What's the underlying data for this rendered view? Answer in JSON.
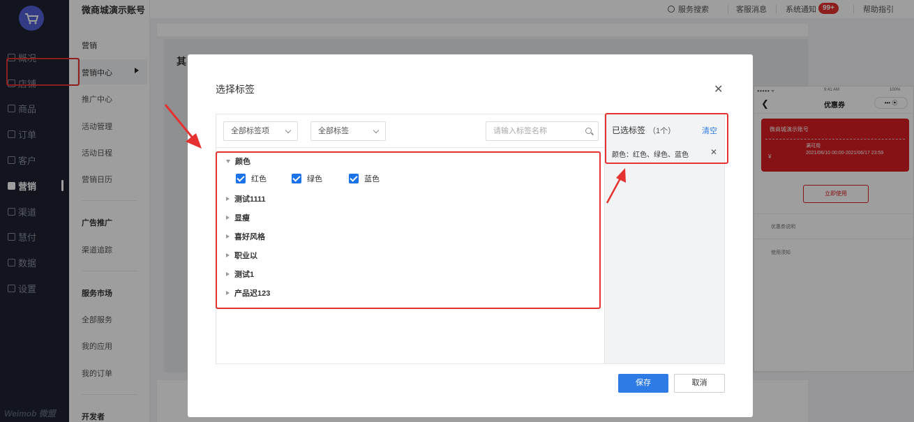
{
  "nav": {
    "items": [
      {
        "label": "概况",
        "icon": "overview-icon"
      },
      {
        "label": "店铺",
        "icon": "shop-icon"
      },
      {
        "label": "商品",
        "icon": "goods-icon"
      },
      {
        "label": "订单",
        "icon": "order-icon"
      },
      {
        "label": "客户",
        "icon": "customer-icon"
      },
      {
        "label": "营销",
        "icon": "marketing-icon"
      },
      {
        "label": "渠道",
        "icon": "channel-icon"
      },
      {
        "label": "慧付",
        "icon": "pay-icon"
      },
      {
        "label": "数据",
        "icon": "data-icon"
      },
      {
        "label": "设置",
        "icon": "settings-icon"
      }
    ],
    "brand": "Weimob 微盟"
  },
  "subnav": {
    "account": "微商城演示账号",
    "section1": "营销",
    "items1": [
      "营销中心",
      "推广中心",
      "活动管理",
      "活动日程",
      "营销日历"
    ],
    "section2": "广告推广",
    "items2": [
      "渠道追踪"
    ],
    "section3": "服务市场",
    "items3": [
      "全部服务",
      "我的应用",
      "我的订单"
    ],
    "section4": "开发者"
  },
  "topbar": {
    "search": "服务搜索",
    "messages": "客服消息",
    "notice": "系统通知",
    "notice_badge": "99+",
    "help": "帮助指引"
  },
  "background": {
    "partial_title": "其"
  },
  "phone": {
    "status_left": "●●●●● ᯤ",
    "status_time": "9:41 AM",
    "status_right": "100%",
    "title": "优惠券",
    "capsule": "•••  ⦿",
    "coupon_name": "微商城演示账号",
    "coupon_status": "满可用",
    "coupon_date": "2021/06/10 00:00-2021/06/17 23:59",
    "coupon_yen": "¥",
    "use_button": "立即使用",
    "label1": "优惠券说明",
    "label2": "使用须知"
  },
  "modal": {
    "title": "选择标签",
    "filter1": "全部标签项",
    "filter2": "全部标签",
    "search_placeholder": "请输入标签名称",
    "groups": [
      {
        "label": "颜色",
        "expanded": true,
        "options": [
          "红色",
          "绿色",
          "蓝色"
        ]
      },
      {
        "label": "测试1111",
        "expanded": false
      },
      {
        "label": "显瘦",
        "expanded": false
      },
      {
        "label": "喜好风格",
        "expanded": false
      },
      {
        "label": "职业以",
        "expanded": false
      },
      {
        "label": "测试1",
        "expanded": false
      },
      {
        "label": "产品迟123",
        "expanded": false
      }
    ],
    "selected_title": "已选标签",
    "selected_count": "（1个）",
    "clear": "清空",
    "selected_item": "颜色：红色、绿色、蓝色",
    "save": "保存",
    "cancel": "取消"
  },
  "colors": {
    "accent": "#2e7be5",
    "annotation": "#e5312f",
    "nav_bg": "#1f2331",
    "coupon": "#d81e22"
  }
}
